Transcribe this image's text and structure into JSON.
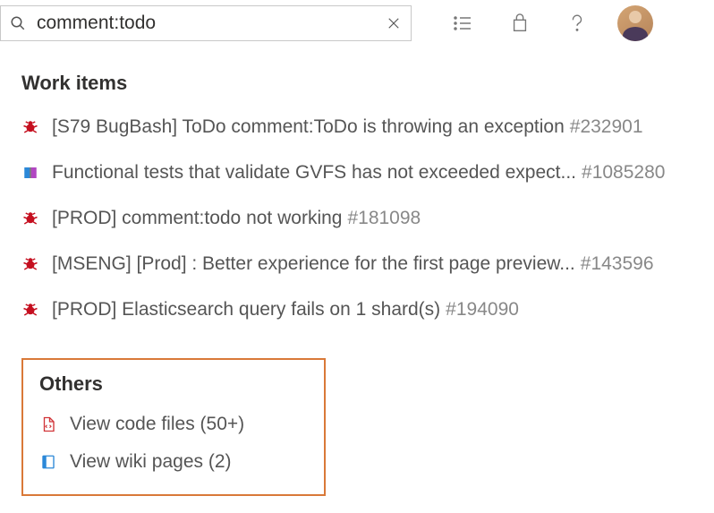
{
  "search": {
    "value": "comment:todo",
    "placeholder": ""
  },
  "sections": {
    "workItems": {
      "title": "Work items",
      "items": [
        {
          "type": "bug",
          "text": "[S79 BugBash] ToDo comment:ToDo is throwing an exception",
          "id": "#232901"
        },
        {
          "type": "doc",
          "text": "Functional tests that validate GVFS has not exceeded expect...",
          "id": "#1085280"
        },
        {
          "type": "bug",
          "text": "[PROD] comment:todo not working",
          "id": "#181098"
        },
        {
          "type": "bug",
          "text": "[MSENG] [Prod] : Better experience for the first page preview...",
          "id": "#143596"
        },
        {
          "type": "bug",
          "text": "[PROD] Elasticsearch query fails on 1 shard(s)",
          "id": "#194090"
        }
      ]
    },
    "others": {
      "title": "Others",
      "items": [
        {
          "type": "code",
          "text": "View code files (50+)"
        },
        {
          "type": "wiki",
          "text": "View wiki pages (2)"
        }
      ]
    }
  }
}
